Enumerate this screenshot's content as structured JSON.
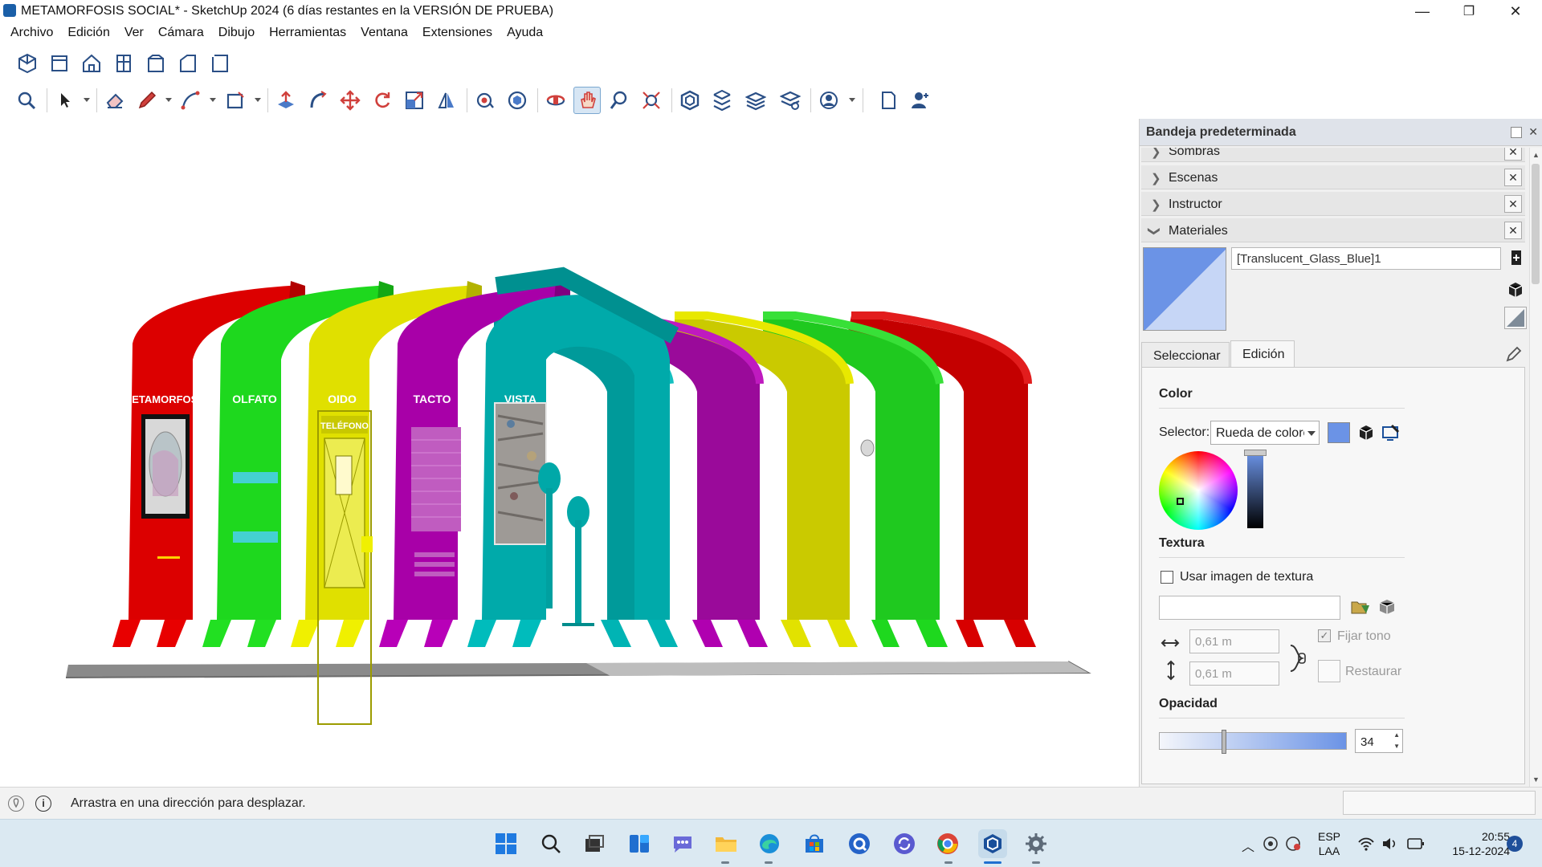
{
  "window": {
    "title": "METAMORFOSIS SOCIAL* - SketchUp 2024 (6 días restantes en la VERSIÓN DE PRUEBA)",
    "minimize_glyph": "—",
    "restore_glyph": "❐",
    "close_glyph": "✕"
  },
  "menu": [
    "Archivo",
    "Edición",
    "Ver",
    "Cámara",
    "Dibujo",
    "Herramientas",
    "Ventana",
    "Extensiones",
    "Ayuda"
  ],
  "toolbar_views": [
    "iso-view-icon",
    "top-view-icon",
    "front-view-icon",
    "right-view-icon",
    "back-view-icon",
    "left-view-icon",
    "bottom-view-icon"
  ],
  "toolbar_tools": [
    "zoom-window-icon",
    "select-icon",
    "eraser-icon",
    "pencil-icon",
    "arc-icon",
    "rectangle-icon",
    "push-pull-icon",
    "follow-me-icon",
    "move-icon",
    "rotate-icon",
    "scale-icon",
    "flip-icon",
    "paint-bucket-icon",
    "components-icon",
    "orbit-icon",
    "pan-icon",
    "zoom-icon",
    "zoom-extents-icon",
    "section-plane-icon",
    "sandbox-icon",
    "layers-icon",
    "styles-icon",
    "user-icon",
    "new-file-icon",
    "account-icon"
  ],
  "model": {
    "arch_labels": [
      "METAMORFOSIS",
      "OLFATO",
      "OIDO",
      "TACTO",
      "VISTA"
    ],
    "booth_label": "TELÉFONO"
  },
  "tray": {
    "title": "Bandeja predeterminada",
    "panels": [
      "Sombras",
      "Escenas",
      "Instructor",
      "Materiales"
    ],
    "material_name": "[Translucent_Glass_Blue]1",
    "tabs": [
      "Seleccionar",
      "Edición"
    ],
    "active_tab": "Edición",
    "color_section": "Color",
    "selector_label": "Selector:",
    "selector_value": "Rueda de colores",
    "texture_section": "Textura",
    "use_texture_label": "Usar imagen de textura",
    "width_value": "0,61 m",
    "height_value": "0,61 m",
    "fix_tone_label": "Fijar tono",
    "restore_label": "Restaurar",
    "opacity_section": "Opacidad",
    "opacity_value": "34",
    "colors": {
      "material": "#6b93e6",
      "material_light": "#c6d6f6"
    }
  },
  "status": {
    "message": "Arrastra en una dirección para desplazar."
  },
  "taskbar": {
    "lang_line1": "ESP",
    "lang_line2": "LAA",
    "time": "20:55",
    "date": "15-12-2024",
    "notifications": "4"
  }
}
